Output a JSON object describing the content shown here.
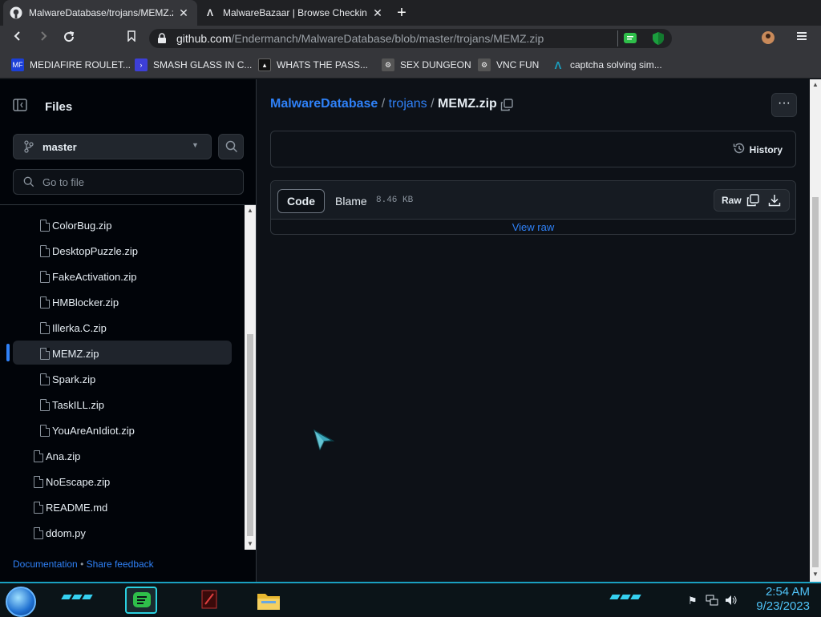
{
  "browser": {
    "tabs": [
      {
        "title": "MalwareDatabase/trojans/MEMZ.z",
        "icon": "github-icon",
        "active": true
      },
      {
        "title": "MalwareBazaar | Browse Checking",
        "icon": "abuse-ch-icon",
        "active": false
      }
    ],
    "url_host": "github.com",
    "url_path": "/Endermanch/MalwareDatabase/blob/master/trojans/MEMZ.zip",
    "bookmarks": [
      {
        "label": "MEDIAFIRE ROULET...",
        "icon": "mediafire-icon",
        "color": "#1b3fd8"
      },
      {
        "label": "SMASH GLASS IN C...",
        "icon": "smash-icon",
        "color": "#3d3fd8"
      },
      {
        "label": "WHATS THE PASS...",
        "icon": "password-icon",
        "color": "#222222"
      },
      {
        "label": "SEX DUNGEON",
        "icon": "dungeon-icon",
        "color": "#555555"
      },
      {
        "label": "VNC FUN",
        "icon": "vnc-icon",
        "color": "#555555"
      },
      {
        "label": "captcha solving sim...",
        "icon": "captcha-icon",
        "color": "#1aa0c0"
      }
    ]
  },
  "sidebar": {
    "title": "Files",
    "branch": "master",
    "goto_placeholder": "Go to file",
    "files": [
      {
        "name": "ColorBug.zip",
        "indent": 2
      },
      {
        "name": "DesktopPuzzle.zip",
        "indent": 2
      },
      {
        "name": "FakeActivation.zip",
        "indent": 2
      },
      {
        "name": "HMBlocker.zip",
        "indent": 2
      },
      {
        "name": "Illerka.C.zip",
        "indent": 2
      },
      {
        "name": "MEMZ.zip",
        "indent": 2,
        "selected": true
      },
      {
        "name": "Spark.zip",
        "indent": 2
      },
      {
        "name": "TaskILL.zip",
        "indent": 2
      },
      {
        "name": "YouAreAnIdiot.zip",
        "indent": 2
      },
      {
        "name": "Ana.zip",
        "indent": 1
      },
      {
        "name": "NoEscape.zip",
        "indent": 1
      },
      {
        "name": "README.md",
        "indent": 1
      },
      {
        "name": "ddom.py",
        "indent": 1
      }
    ],
    "footer_docs": "Documentation",
    "footer_sep": "•",
    "footer_feedback": "Share feedback"
  },
  "main": {
    "crumb_repo": "MalwareDatabase",
    "crumb_sep": "/",
    "crumb_dir": "trojans",
    "crumb_file": "MEMZ.zip",
    "history_label": "History",
    "code_label": "Code",
    "blame_label": "Blame",
    "file_size": "8.46 KB",
    "raw_label": "Raw",
    "view_raw": "View raw"
  },
  "taskbar": {
    "time": "2:54 AM",
    "date": "9/23/2023",
    "accent": "#1aa0c0"
  }
}
